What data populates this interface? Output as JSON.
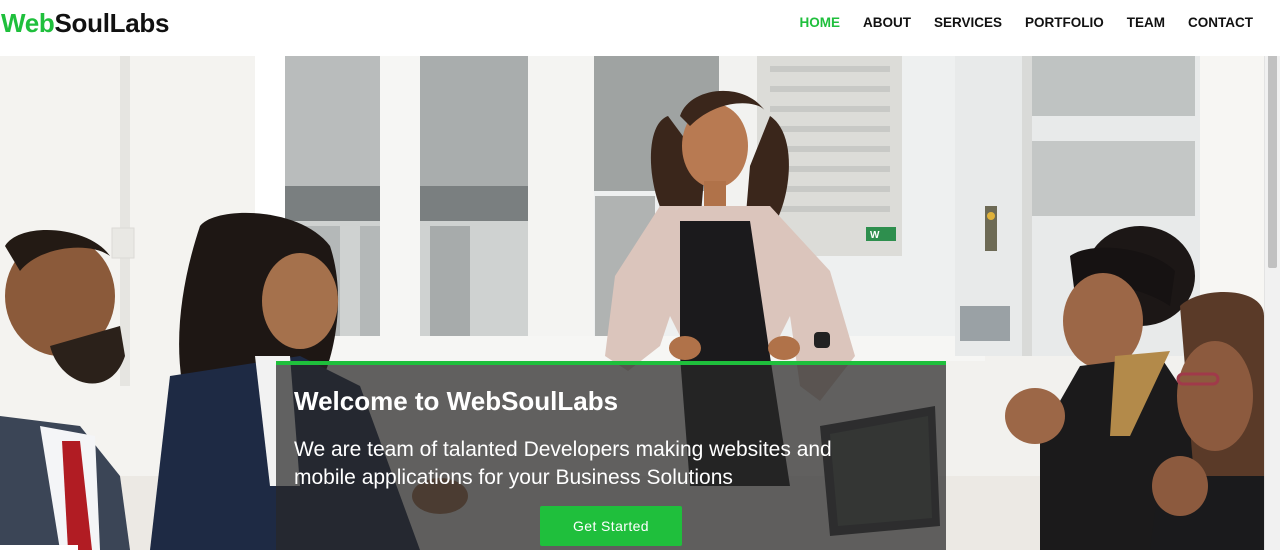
{
  "brand": {
    "part1": "Web",
    "part2": "SoulLabs"
  },
  "nav": {
    "items": [
      {
        "label": "HOME"
      },
      {
        "label": "ABOUT"
      },
      {
        "label": "SERVICES"
      },
      {
        "label": "PORTFOLIO"
      },
      {
        "label": "TEAM"
      },
      {
        "label": "CONTACT"
      }
    ],
    "active_index": 0
  },
  "hero": {
    "title": "Welcome to WebSoulLabs",
    "subtitle": "We are team of talanted Developers making websites and mobile applications for your Business Solutions",
    "cta_label": "Get Started",
    "sign_text": "W"
  },
  "colors": {
    "accent": "#1fbf3c",
    "text_dark": "#111111",
    "overlay": "rgba(40,40,40,0.72)"
  }
}
